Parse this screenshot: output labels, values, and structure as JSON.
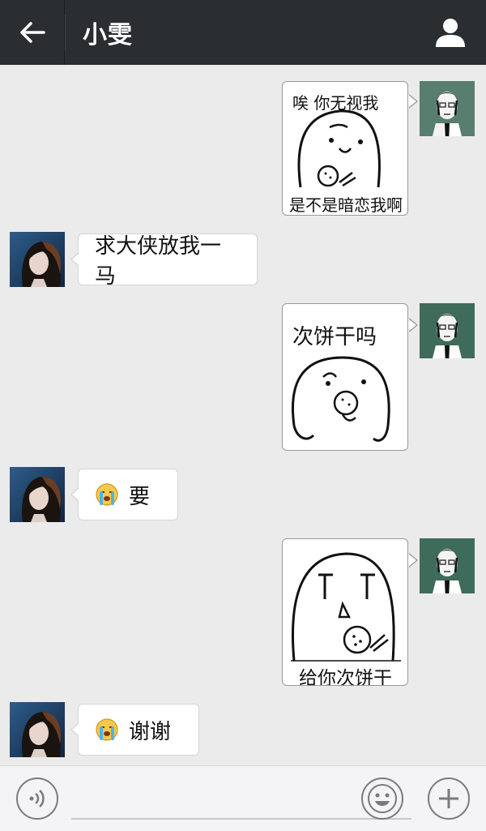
{
  "header": {
    "title": "小雯"
  },
  "messages": [
    {
      "side": "right",
      "type": "sticker",
      "top_text": "唉 你无视我",
      "bottom_text": "是不是暗恋我啊"
    },
    {
      "side": "left",
      "type": "text",
      "text": "求大侠放我一马"
    },
    {
      "side": "right",
      "type": "sticker",
      "top_text": "次饼干吗"
    },
    {
      "side": "left",
      "type": "text",
      "text": "要",
      "emoji": "crying-face-icon"
    },
    {
      "side": "right",
      "type": "sticker",
      "bottom_text": "给你次饼干"
    },
    {
      "side": "left",
      "type": "text",
      "text": "谢谢",
      "emoji": "crying-face-icon"
    }
  ],
  "input": {
    "value": ""
  },
  "icons": {
    "back": "back-arrow-icon",
    "profile": "person-icon",
    "voice": "voice-icon",
    "emoji": "smiley-icon",
    "plus": "plus-icon"
  },
  "colors": {
    "header_bg": "#2b2e31",
    "chat_bg": "#ebebeb",
    "bubble_bg": "#ffffff"
  }
}
